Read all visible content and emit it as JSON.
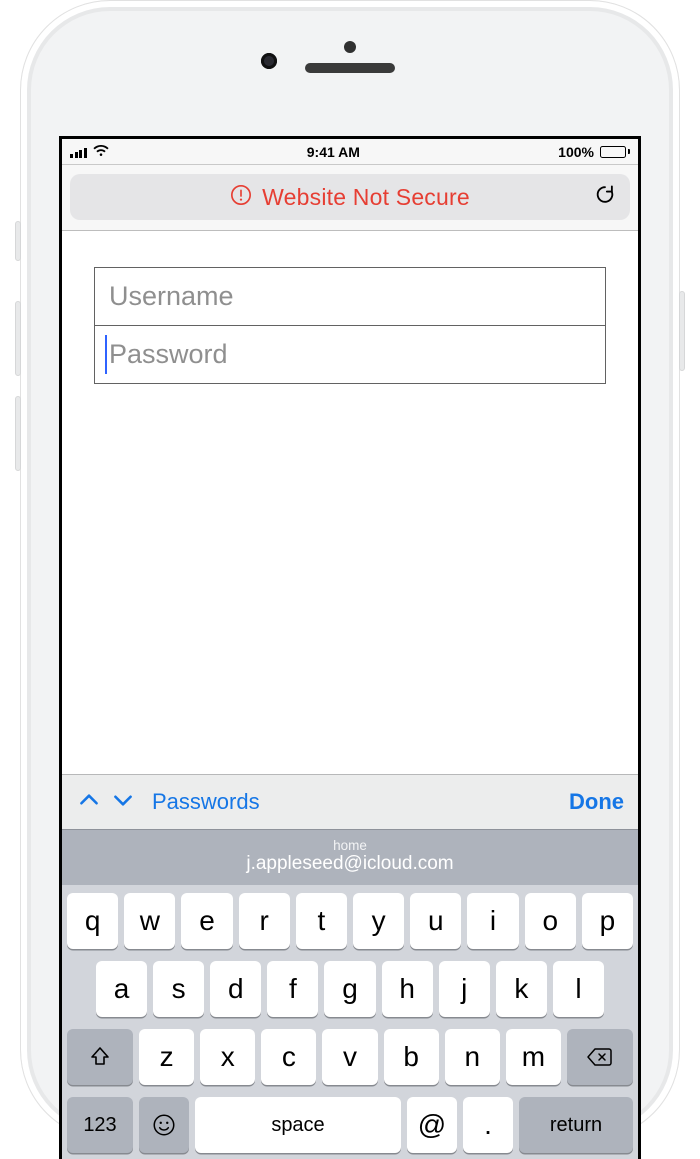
{
  "statusbar": {
    "time": "9:41 AM",
    "battery_pct": "100%"
  },
  "addressbar": {
    "title": "Website Not Secure"
  },
  "form": {
    "username_placeholder": "Username",
    "password_placeholder": "Password"
  },
  "accessory": {
    "passwords_label": "Passwords",
    "done_label": "Done"
  },
  "quicktype": {
    "context": "home",
    "credential": "j.appleseed@icloud.com"
  },
  "keyboard": {
    "row1": [
      "q",
      "w",
      "e",
      "r",
      "t",
      "y",
      "u",
      "i",
      "o",
      "p"
    ],
    "row2": [
      "a",
      "s",
      "d",
      "f",
      "g",
      "h",
      "j",
      "k",
      "l"
    ],
    "row3": [
      "z",
      "x",
      "c",
      "v",
      "b",
      "n",
      "m"
    ],
    "mode_key": "123",
    "space_key": "space",
    "at_key": "@",
    "dot_key": ".",
    "return_key": "return"
  }
}
